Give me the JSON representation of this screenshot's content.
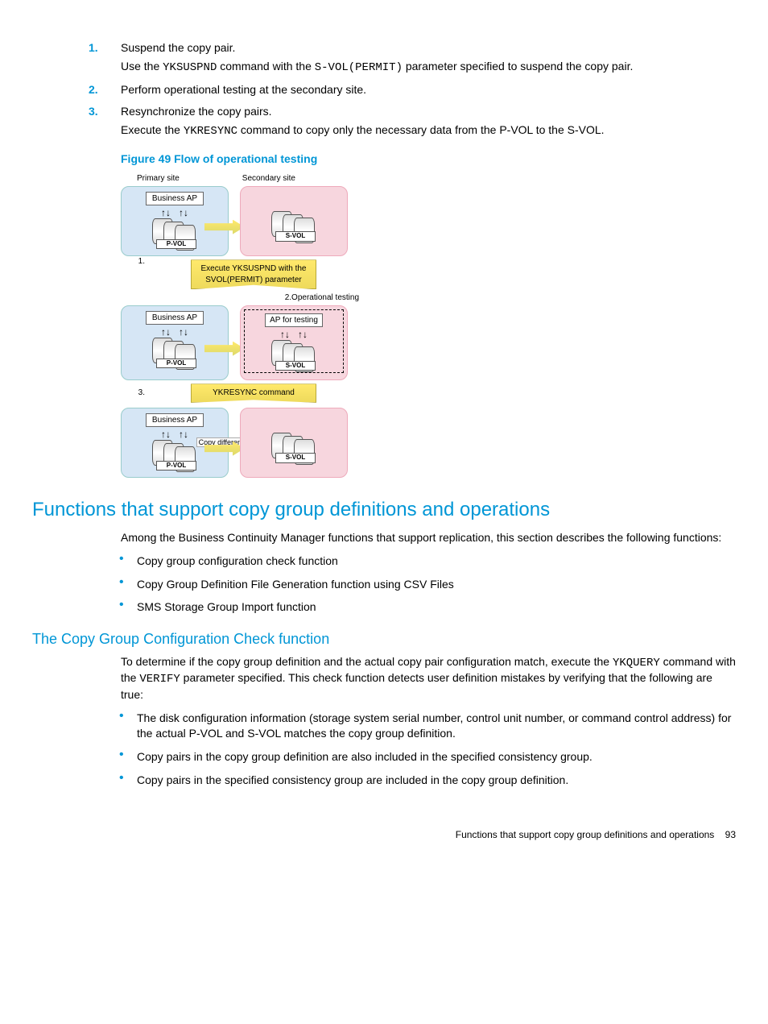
{
  "steps": [
    {
      "n": "1.",
      "title": "Suspend the copy pair.",
      "detail_pre": "Use the ",
      "cmd1": "YKSUSPND",
      "detail_mid": " command with the ",
      "cmd2": "S-VOL(PERMIT)",
      "detail_post": " parameter specified to suspend the copy pair."
    },
    {
      "n": "2.",
      "title": "Perform operational testing at the secondary site.",
      "detail_pre": "",
      "cmd1": "",
      "detail_mid": "",
      "cmd2": "",
      "detail_post": ""
    },
    {
      "n": "3.",
      "title": "Resynchronize the copy pairs.",
      "detail_pre": "Execute the ",
      "cmd1": "YKRESYNC",
      "detail_mid": " command to copy only the necessary data from the P-VOL to the S-VOL.",
      "cmd2": "",
      "detail_post": ""
    }
  ],
  "figcaption": "Figure 49 Flow of operational testing",
  "diagram": {
    "primary": "Primary site",
    "secondary": "Secondary site",
    "businessAP": "Business AP",
    "apTesting": "AP for testing",
    "pvol": "P-VOL",
    "svol": "S-VOL",
    "step1_num": "1.",
    "step1_text": "Execute YKSUSPND with the SVOL(PERMIT) parameter",
    "step2": "2.Operational testing",
    "step3_num": "3.",
    "step3_text": "YKRESYNC command",
    "copydiff": "Copy differences"
  },
  "h1": "Functions that support copy group definitions and operations",
  "p1": "Among the Business Continuity Manager functions that support replication, this section describes the following functions:",
  "list1": [
    "Copy group configuration check function",
    "Copy Group Definition File Generation function using CSV Files",
    "SMS Storage Group Import function"
  ],
  "h2": "The Copy Group Configuration Check function",
  "p2_pre": "To determine if the copy group definition and the actual copy pair configuration match, execute the ",
  "p2_cmd1": "YKQUERY",
  "p2_mid": " command with the ",
  "p2_cmd2": "VERIFY",
  "p2_post": " parameter specified. This check function detects user definition mistakes by verifying that the following are true:",
  "list2": [
    "The disk configuration information (storage system serial number, control unit number, or command control address) for the actual P-VOL and S-VOL matches the copy group definition.",
    "Copy pairs in the copy group definition are also included in the specified consistency group.",
    "Copy pairs in the specified consistency group are included in the copy group definition."
  ],
  "footer_text": "Functions that support copy group definitions and operations",
  "footer_page": "93"
}
